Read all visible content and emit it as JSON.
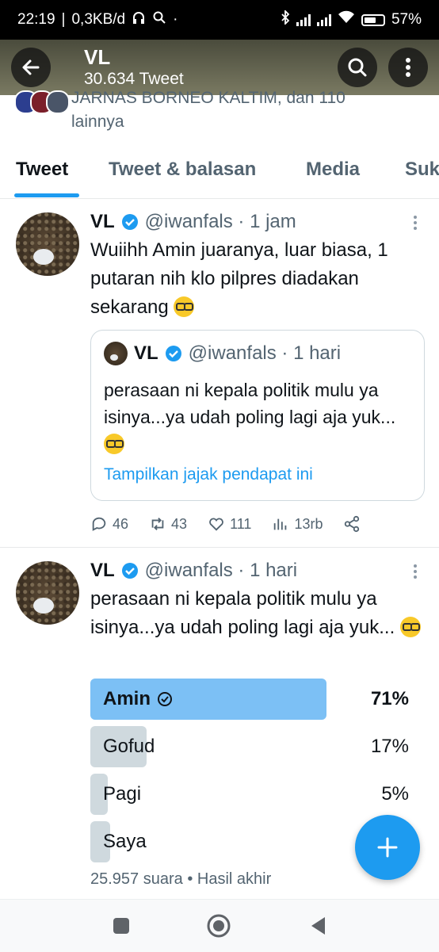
{
  "status_bar": {
    "time": "22:19",
    "network": "0,3KB/d",
    "battery": "57%"
  },
  "header": {
    "name": "VL",
    "tweet_count": "30.634 Tweet"
  },
  "followed_by": {
    "line1": "JARNAS BORNEO KALTIM, dan 110",
    "line2": "lainnya"
  },
  "tabs": [
    {
      "label": "Tweet",
      "active": true
    },
    {
      "label": "Tweet & balasan",
      "active": false
    },
    {
      "label": "Media",
      "active": false
    },
    {
      "label": "Suka",
      "active": false
    }
  ],
  "tweet1": {
    "name": "VL",
    "handle_time": "@iwanfals · 1 jam",
    "text": "Wuiihh Amin juaranya, luar biasa, 1 putaran nih klo pilpres diadakan sekarang",
    "emoji": "nerd-face",
    "quote": {
      "name": "VL",
      "handle_time": "@iwanfals · 1 hari",
      "text": "perasaan ni kepala politik mulu ya isinya...ya udah poling lagi aja yuk...",
      "link": "Tampilkan jajak pendapat ini"
    },
    "actions": {
      "replies": "46",
      "retweets": "43",
      "likes": "111",
      "views": "13rb"
    }
  },
  "tweet2": {
    "name": "VL",
    "handle_time": "@iwanfals · 1 hari",
    "text": "perasaan ni kepala politik mulu ya isinya...ya udah poling lagi aja yuk...",
    "poll": {
      "options": [
        {
          "label": "Amin",
          "percent": "71%",
          "fraction": 0.71,
          "winner": true
        },
        {
          "label": "Gofud",
          "percent": "17%",
          "fraction": 0.17,
          "winner": false
        },
        {
          "label": "Pagi",
          "percent": "5%",
          "fraction": 0.05,
          "winner": false
        },
        {
          "label": "Saya",
          "percent": "",
          "fraction": 0.06,
          "winner": false
        }
      ],
      "meta": "25.957 suara • Hasil akhir"
    }
  },
  "colors": {
    "accent": "#1d9bf0",
    "poll_winner": "#7cc0f5",
    "poll_other": "#cfd9de",
    "header_bg": "#5a5b48"
  }
}
